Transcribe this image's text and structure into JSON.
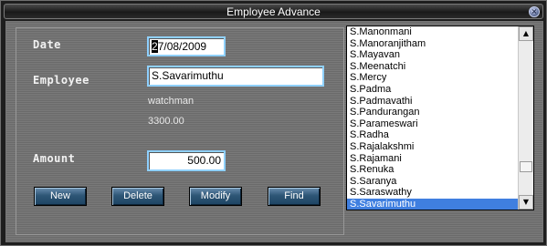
{
  "window": {
    "title": "Employee Advance",
    "close_glyph": "×"
  },
  "form": {
    "date_label": "Date",
    "date_value_first": "2",
    "date_value_rest": "7/08/2009",
    "employee_label": "Employee",
    "employee_value": "S.Savarimuthu",
    "designation": "watchman",
    "salary": "3300.00",
    "amount_label": "Amount",
    "amount_value": "500.00"
  },
  "buttons": {
    "new_label": "New",
    "delete_label": "Delete",
    "modify_label": "Modify",
    "find_label": "Find"
  },
  "employee_list": {
    "items": [
      "S.Manonmani",
      "S.Manoranjitham",
      "S.Mayavan",
      "S.Meenatchi",
      "S.Mercy",
      "S.Padma",
      "S.Padmavathi",
      "S.Pandurangan",
      "S.Parameswari",
      "S.Radha",
      "S.Rajalakshmi",
      "S.Rajamani",
      "S.Renuka",
      "S.Saranya",
      "S.Saraswathy",
      "S.Savarimuthu"
    ],
    "selected": "S.Savarimuthu",
    "scroll_up_icon": "up-arrow",
    "scroll_down_icon": "down-arrow",
    "up_glyph": "▲",
    "down_glyph": "▼"
  }
}
